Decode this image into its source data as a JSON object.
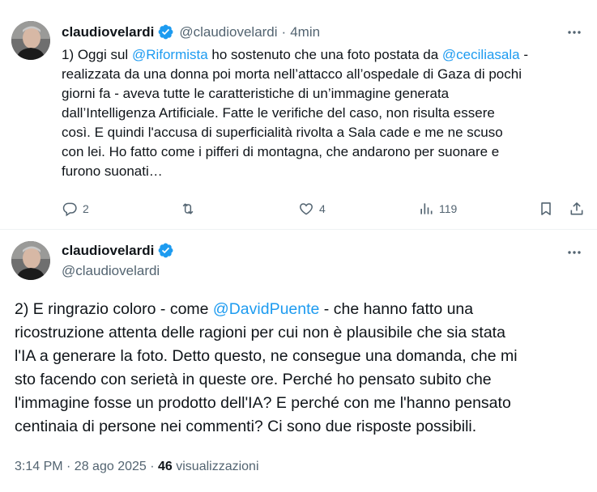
{
  "tweet1": {
    "author_name": "claudiovelardi",
    "author_handle": "@claudiovelardi",
    "separator": "·",
    "time": "4min",
    "lines": [
      [
        {
          "t": "1) Oggi sul "
        },
        {
          "t": "@Riformista",
          "m": true
        },
        {
          "t": " ho sostenuto che una foto postata da "
        },
        {
          "t": "@ceciliasala",
          "m": true
        },
        {
          "t": " -"
        }
      ],
      [
        {
          "t": "realizzata da una donna poi morta nell’attacco all’ospedale di Gaza di pochi"
        }
      ],
      [
        {
          "t": "giorni fa - aveva tutte le caratteristiche di un’immagine generata"
        }
      ],
      [
        {
          "t": "dall’Intelligenza Artificiale. Fatte le verifiche del caso, non risulta essere"
        }
      ],
      [
        {
          "t": "così. E quindi l'accusa di superficialità rivolta a Sala cade e me ne scuso"
        }
      ],
      [
        {
          "t": "con lei. Ho fatto come i pifferi di montagna, che andarono per suonare e"
        }
      ],
      [
        {
          "t": "furono suonati…"
        }
      ]
    ],
    "actions": {
      "replies": "2",
      "retweets": "",
      "likes": "4",
      "views": "119"
    }
  },
  "tweet2": {
    "author_name": "claudiovelardi",
    "author_handle": "@claudiovelardi",
    "lines": [
      [
        {
          "t": "2) E ringrazio coloro - come "
        },
        {
          "t": "@DavidPuente",
          "m": true
        },
        {
          "t": " - che hanno fatto una"
        }
      ],
      [
        {
          "t": "ricostruzione attenta delle ragioni per cui non è plausibile che sia stata"
        }
      ],
      [
        {
          "t": "l'IA a generare la foto. Detto questo, ne consegue una domanda, che mi"
        }
      ],
      [
        {
          "t": "sto facendo con serietà in queste ore. Perché ho pensato subito che"
        }
      ],
      [
        {
          "t": "l'immagine fosse un prodotto dell'IA? E perché con me l'hanno pensato"
        }
      ],
      [
        {
          "t": "centinaia di persone nei commenti? Ci sono due risposte possibili."
        }
      ]
    ],
    "meta": {
      "timestamp": "3:14 PM · 28 ago 2025 · ",
      "views_count": "46",
      "views_label": " visualizzazioni"
    }
  },
  "colors": {
    "link": "#1d9bf0",
    "verified": "#1d9bf0",
    "muted": "#536471",
    "text": "#0f1419",
    "divider": "#eff3f4"
  },
  "icons": [
    "verified-badge-icon",
    "more-options-icon",
    "reply-icon",
    "retweet-icon",
    "like-icon",
    "views-icon",
    "bookmark-icon",
    "share-icon"
  ]
}
